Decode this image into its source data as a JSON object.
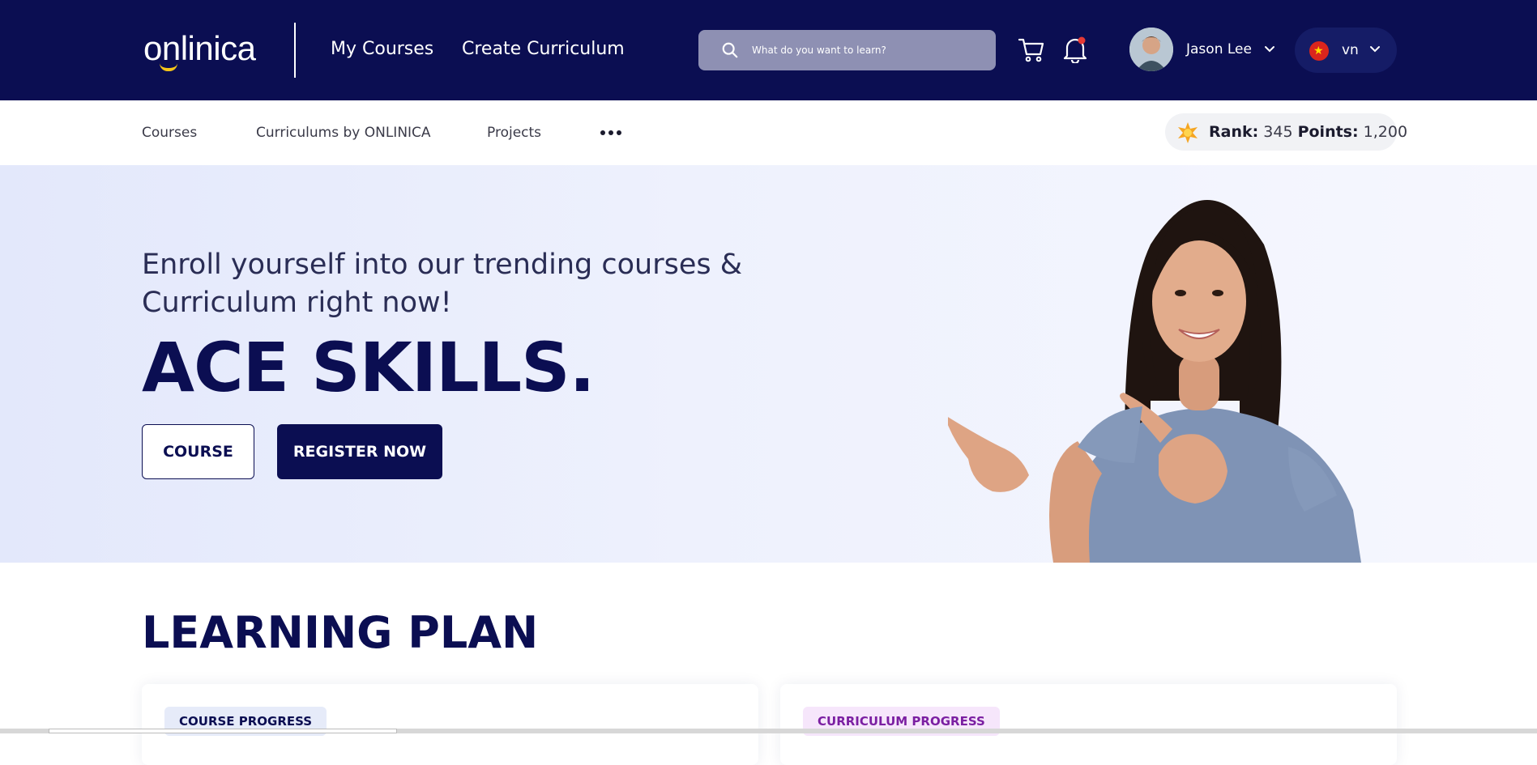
{
  "header": {
    "logo_text": "onlinica",
    "nav": {
      "my_courses": "My Courses",
      "create_curriculum": "Create Curriculum"
    },
    "search": {
      "placeholder": "What do you want to learn?"
    },
    "user": {
      "name": "Jason Lee"
    },
    "language": {
      "code": "vn"
    }
  },
  "subnav": {
    "items": [
      "Courses",
      "Curriculums by ONLINICA",
      "Projects"
    ],
    "rank_label": "Rank:",
    "rank_value": "345",
    "points_label": "Points:",
    "points_value": "1,200"
  },
  "hero": {
    "subtitle": "Enroll yourself into our trending courses & Curriculum right now!",
    "title": "ACE SKILLS.",
    "course_button": "COURSE",
    "register_button": "REGISTER NOW"
  },
  "learning_plan": {
    "title": "LEARNING PLAN",
    "course_tag": "COURSE PROGRESS",
    "curriculum_tag": "CURRICULUM PROGRESS"
  },
  "colors": {
    "navy": "#0b0e52",
    "accent_yellow": "#f5c518",
    "curriculum_purple": "#7b1fa2"
  },
  "icons": [
    "search-icon",
    "cart-icon",
    "bell-icon",
    "chevron-down-icon",
    "more-icon",
    "star-badge-icon"
  ]
}
